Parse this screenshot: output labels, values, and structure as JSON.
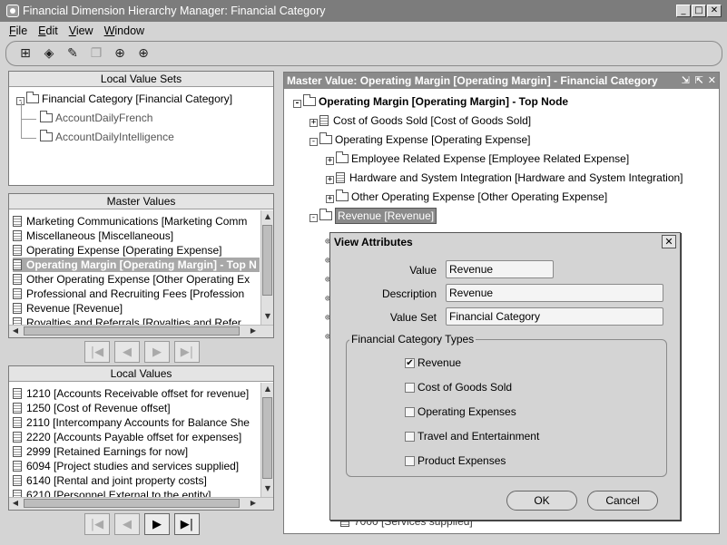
{
  "window": {
    "title": "Financial Dimension Hierarchy Manager: Financial Category"
  },
  "menu": [
    "File",
    "Edit",
    "View",
    "Window"
  ],
  "toolbar": [
    {
      "icon": "hierarchy-icon",
      "glyph": "⊞",
      "enabled": true
    },
    {
      "icon": "eraser-icon",
      "glyph": "◈",
      "enabled": true
    },
    {
      "icon": "flashlight-icon",
      "glyph": "✎",
      "enabled": true
    },
    {
      "icon": "copy-icon",
      "glyph": "❐",
      "enabled": false
    },
    {
      "icon": "add-folder-icon",
      "glyph": "⊕",
      "enabled": true
    },
    {
      "icon": "add-document-icon",
      "glyph": "⊕",
      "enabled": true
    }
  ],
  "local_value_sets": {
    "header": "Local Value Sets",
    "root": "Financial Category  [Financial Category]",
    "children": [
      "AccountDailyFrench",
      "AccountDailyIntelligence"
    ]
  },
  "master_values": {
    "header": "Master Values",
    "items": [
      "Marketing Communications  [Marketing Comm",
      "Miscellaneous  [Miscellaneous]",
      "Operating Expense  [Operating Expense]",
      "Operating Margin  [Operating Margin] - Top N",
      "Other Operating Expense  [Other Operating Ex",
      "Professional and Recruiting Fees  [Profession",
      "Revenue  [Revenue]",
      "Royalties and Referrals  [Royalties and Refer"
    ],
    "selected_index": 3
  },
  "local_values": {
    "header": "Local Values",
    "items": [
      "1210  [Accounts Receivable offset for revenue]",
      "1250  [Cost of Revenue offset]",
      "2110  [Intercompany Accounts for Balance She",
      "2220  [Accounts Payable offset for expenses]",
      "2999  [Retained Earnings for now]",
      "6094  [Project studies and services supplied]",
      "6140  [Rental and joint property costs]",
      "6210  [Personnel External to the entity]"
    ]
  },
  "master_value_panel": {
    "header": "Master Value: Operating Margin [Operating Margin] - Financial Category",
    "tree": [
      {
        "label": "Operating Margin [Operating Margin] - Top Node",
        "type": "folder",
        "toggle": "-",
        "level": 0,
        "bold": true
      },
      {
        "label": "Cost of Goods Sold [Cost of Goods Sold]",
        "type": "doc",
        "toggle": "+",
        "level": 1
      },
      {
        "label": "Operating Expense [Operating Expense]",
        "type": "folder",
        "toggle": "-",
        "level": 1
      },
      {
        "label": "Employee Related Expense [Employee Related Expense]",
        "type": "folder",
        "toggle": "+",
        "level": 2
      },
      {
        "label": "Hardware and System Integration [Hardware and System Integration]",
        "type": "doc",
        "toggle": "+",
        "level": 2
      },
      {
        "label": "Other Operating Expense [Other Operating Expense]",
        "type": "folder",
        "toggle": "+",
        "level": 2
      },
      {
        "label": "Revenue [Revenue]",
        "type": "folder",
        "toggle": "-",
        "level": 1,
        "selected": true
      }
    ],
    "bottom_item": "7000 [Services supplied]"
  },
  "dialog": {
    "title": "View Attributes",
    "fields": [
      {
        "label": "Value",
        "value": "Revenue"
      },
      {
        "label": "Description",
        "value": "Revenue"
      },
      {
        "label": "Value Set",
        "value": "Financial Category"
      }
    ],
    "group_title": "Financial Category Types",
    "types": [
      {
        "label": "Revenue",
        "checked": true
      },
      {
        "label": "Cost of Goods Sold",
        "checked": false
      },
      {
        "label": "Operating Expenses",
        "checked": false
      },
      {
        "label": "Travel and Entertainment",
        "checked": false
      },
      {
        "label": "Product Expenses",
        "checked": false
      }
    ],
    "ok_label": "OK",
    "cancel_label": "Cancel"
  }
}
